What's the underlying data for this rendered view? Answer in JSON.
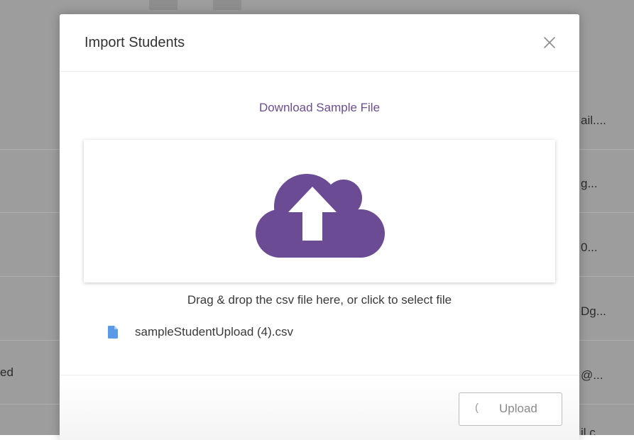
{
  "background": {
    "left_cell_text": "ed",
    "right_cell_texts": [
      "ail....",
      "g...",
      "0...",
      "Dg...",
      "@...",
      "il.c..."
    ]
  },
  "modal": {
    "title": "Import Students",
    "close_icon": "close-icon",
    "download_link": "Download Sample File",
    "dropzone": {
      "icon": "cloud-upload-icon",
      "icon_color": "#6a4b94",
      "hint": "Drag & drop the csv file here, or click to select file"
    },
    "selected_file": {
      "icon": "file-icon",
      "icon_color": "#5a9ae6",
      "name": "sampleStudentUpload (4).csv"
    },
    "footer": {
      "upload_spinner": "(",
      "upload_label": "Upload"
    }
  }
}
